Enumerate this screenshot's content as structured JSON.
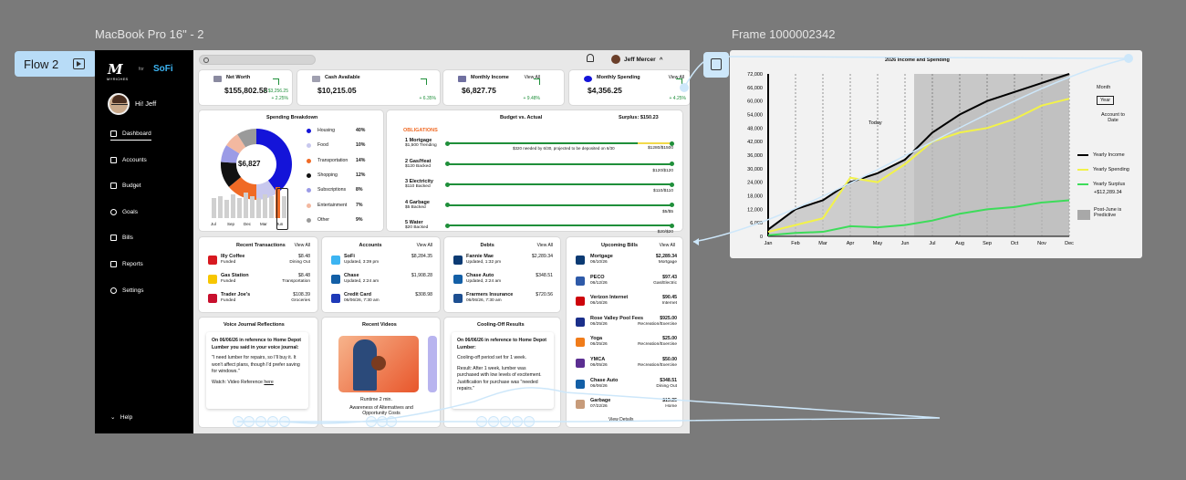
{
  "canvas": {
    "frame1_label": "MacBook Pro 16\" - 2",
    "frame2_label": "Frame 1000002342",
    "flow_label": "Flow 2"
  },
  "sidebar": {
    "logo_text": "M",
    "logo_sub": "MYRICHES",
    "logo_for": "for",
    "logo_partner": "SoFi",
    "greeting": "Hi! Jeff",
    "items": [
      {
        "label": "Dashboard",
        "icon": "home-icon",
        "active": true
      },
      {
        "label": "Accounts",
        "icon": "accounts-icon",
        "active": false
      },
      {
        "label": "Budget",
        "icon": "budget-icon",
        "active": false
      },
      {
        "label": "Goals",
        "icon": "goals-icon",
        "active": false
      },
      {
        "label": "Bills",
        "icon": "bills-icon",
        "active": false
      },
      {
        "label": "Reports",
        "icon": "reports-icon",
        "active": false
      },
      {
        "label": "Settings",
        "icon": "settings-icon",
        "active": false
      }
    ],
    "help": "Help"
  },
  "topbar": {
    "user_name": "Jeff Mercer"
  },
  "kpis": [
    {
      "title": "Net Worth",
      "value": "$155,802.58",
      "delta1": "+ $3,256.25",
      "delta2": "+ 2.25%",
      "view_all": ""
    },
    {
      "title": "Cash Available",
      "value": "$10,215.05",
      "delta1": "",
      "delta2": "+ 6.35%",
      "view_all": ""
    },
    {
      "title": "Monthly Income",
      "value": "$6,827.75",
      "delta1": "",
      "delta2": "+ 9.48%",
      "view_all": "View All"
    },
    {
      "title": "Monthly Spending",
      "value": "$4,356.25",
      "delta1": "",
      "delta2": "+ 4.25%",
      "view_all": "View All"
    }
  ],
  "spending": {
    "title": "Spending Breakdown",
    "total": "$6,827",
    "categories": [
      {
        "name": "Housing",
        "pct": "40%",
        "value": 40,
        "color": "#1414d9"
      },
      {
        "name": "Food",
        "pct": "10%",
        "value": 10,
        "color": "#c8c8ee"
      },
      {
        "name": "Transportation",
        "pct": "14%",
        "value": 14,
        "color": "#f06a25"
      },
      {
        "name": "Shopping",
        "pct": "12%",
        "value": 12,
        "color": "#111111"
      },
      {
        "name": "Subscriptions",
        "pct": "8%",
        "value": 8,
        "color": "#9b9be6"
      },
      {
        "name": "Entertainment",
        "pct": "7%",
        "value": 7,
        "color": "#f3b8a0"
      },
      {
        "name": "Other",
        "pct": "9%",
        "value": 9,
        "color": "#9a9a9a"
      }
    ],
    "bar_labels": [
      "Jul",
      "Sep",
      "Dec",
      "Mar",
      "Jun"
    ],
    "bar_values": [
      0.55,
      0.6,
      0.5,
      0.65,
      0.55,
      0.7,
      0.6,
      0.55,
      0.65,
      0.6,
      0.85,
      0.6
    ]
  },
  "budget": {
    "title": "Budget vs. Actual",
    "surplus": "Surplus: $150.23",
    "section": "OBLIGATIONS",
    "note": "$320 needed by 6/30, projected to be deposited on 6/30",
    "items": [
      {
        "name": "1 Mortgage",
        "sub": "$1,500 Trending",
        "amount": "$1280/$1500",
        "fill": 0.85,
        "partial": true
      },
      {
        "name": "2 Gas/Heat",
        "sub": "$120 Backed",
        "amount": "$120/$120",
        "fill": 1,
        "partial": false
      },
      {
        "name": "3 Electricity",
        "sub": "$110 Backed",
        "amount": "$110/$110",
        "fill": 1,
        "partial": false
      },
      {
        "name": "4 Garbage",
        "sub": "$5 Backed",
        "amount": "$5/$5",
        "fill": 1,
        "partial": false
      },
      {
        "name": "5 Water",
        "sub": "$20 Backed",
        "amount": "$20/$20",
        "fill": 1,
        "partial": false
      }
    ]
  },
  "transactions": {
    "title": "Recent Transactions",
    "view_all": "View All",
    "items": [
      {
        "name": "Illy Coffee",
        "status": "Funded",
        "amount": "$8.48",
        "category": "Dining Out",
        "icon": "illy-logo-icon",
        "color": "#d71920"
      },
      {
        "name": "Gas Station",
        "status": "Funded",
        "amount": "$8.48",
        "category": "Transportation",
        "icon": "shell-logo-icon",
        "color": "#f7c600"
      },
      {
        "name": "Trader Joe's",
        "status": "Funded",
        "amount": "$108.39",
        "category": "Groceries",
        "icon": "trader-joes-logo-icon",
        "color": "#c8102e"
      }
    ]
  },
  "accounts": {
    "title": "Accounts",
    "view_all": "View All",
    "items": [
      {
        "name": "SoFi",
        "updated": "Updated, 3:39 pm",
        "amount": "$8,284.35",
        "icon": "sofi-logo-icon",
        "color": "#3cb4f2"
      },
      {
        "name": "Chase",
        "updated": "Updated, 2:24 am",
        "amount": "$1,908.28",
        "icon": "chase-logo-icon",
        "color": "#135fa6"
      },
      {
        "name": "Credit Card",
        "updated": "06/06/26, 7:30 am",
        "amount": "$308.98",
        "icon": "card-logo-icon",
        "color": "#1e3ab8"
      }
    ]
  },
  "debts": {
    "title": "Debts",
    "view_all": "View All",
    "items": [
      {
        "name": "Fannie Mae",
        "updated": "Updated, 1:32 pm",
        "amount": "$2,289.34",
        "icon": "fannie-mae-logo-icon",
        "color": "#0b3a73"
      },
      {
        "name": "Chase Auto",
        "updated": "Updated, 2:24 am",
        "amount": "$348.51",
        "icon": "chase-logo-icon",
        "color": "#135fa6"
      },
      {
        "name": "Frarmers Insurance",
        "updated": "06/06/26, 7:30 am",
        "amount": "$720.56",
        "icon": "farmers-logo-icon",
        "color": "#1d4f91"
      }
    ]
  },
  "bills": {
    "title": "Upcoming Bills",
    "view_all": "View All",
    "view_details": "View Details",
    "items": [
      {
        "name": "Mortgage",
        "date": "06/10/26",
        "amount": "$2,289.34",
        "category": "Mortgage",
        "icon": "fannie-mae-logo-icon",
        "color": "#0b3a73"
      },
      {
        "name": "PECO",
        "date": "06/12/26",
        "amount": "$97.43",
        "category": "Gas/Electric",
        "icon": "peco-logo-icon",
        "color": "#2e5aa8"
      },
      {
        "name": "Verizon Internet",
        "date": "06/16/26",
        "amount": "$90.45",
        "category": "Internet",
        "icon": "verizon-logo-icon",
        "color": "#cd040b"
      },
      {
        "name": "Rose Valley Pool Fees",
        "date": "06/25/26",
        "amount": "$925.00",
        "category": "Recreation/Exercise",
        "icon": "pool-logo-icon",
        "color": "#1a2f8a"
      },
      {
        "name": "Yoga",
        "date": "06/25/26",
        "amount": "$25.00",
        "category": "Recreation/Exercise",
        "icon": "yoga-logo-icon",
        "color": "#f07c1a"
      },
      {
        "name": "YMCA",
        "date": "06/05/26",
        "amount": "$50.00",
        "category": "Recreation/Exercise",
        "icon": "ymca-logo-icon",
        "color": "#5b2e91"
      },
      {
        "name": "Chase Auto",
        "date": "06/06/26",
        "amount": "$348.51",
        "category": "Dining Out",
        "icon": "chase-logo-icon",
        "color": "#135fa6"
      },
      {
        "name": "Garbage",
        "date": "07/22/26",
        "amount": "$15.25",
        "category": "Home",
        "icon": "garbage-logo-icon",
        "color": "#c79b7a"
      }
    ]
  },
  "journal": {
    "title": "Voice Journal Reflections",
    "heading": "On 06/06/26 in reference to Home Depot Lumber you said in your voice journal:",
    "quote": "\"I need lumber for repairs, so I'll buy it. It won't affect plans, though I'd prefer saving for windows.\"",
    "watch": "Watch: Video Reference",
    "here": "here"
  },
  "videos": {
    "title": "Recent Videos",
    "runtime": "Runtime 2 min.",
    "caption": "Awareness of Alternatives and Opportunity Costs"
  },
  "cooling": {
    "title": "Cooling-Off Results",
    "heading": "On 06/06/26 in reference to Home Depot Lumber:",
    "period": "Cooling-off period set for 1 week.",
    "result": "Result: After 1 week, lumber was purchased with low levels of excitement. Justification for purchase was \"needed repairs.\""
  },
  "chart_data": {
    "type": "line",
    "title": "2026 Income and Spending",
    "x": [
      "Jan",
      "Feb",
      "Mar",
      "Apr",
      "May",
      "Jun",
      "Jul",
      "Aug",
      "Sep",
      "Oct",
      "Nov",
      "Dec"
    ],
    "y_ticks": [
      "72,000",
      "66,000",
      "60,000",
      "54,000",
      "48,000",
      "42,000",
      "36,000",
      "30,000",
      "24,000",
      "18,000",
      "12,000",
      "6,000",
      "0"
    ],
    "ylim": [
      0,
      72000
    ],
    "annotation": "Today",
    "series": [
      {
        "name": "Yearly Income",
        "color": "#000000",
        "values": [
          3000,
          12000,
          16000,
          24000,
          28000,
          34000,
          46000,
          54000,
          60000,
          64000,
          68000,
          72000
        ]
      },
      {
        "name": "Yearly Spending",
        "color": "#f2f24a",
        "values": [
          2000,
          5000,
          8000,
          26000,
          24000,
          32000,
          42000,
          46000,
          48000,
          52000,
          58000,
          61000
        ]
      },
      {
        "name": "Yearly Surplus",
        "color": "#3ddc5a",
        "values": [
          500,
          1500,
          2000,
          4500,
          4000,
          5000,
          7000,
          10000,
          12000,
          13000,
          15000,
          16000
        ]
      }
    ],
    "surplus_total": "+$12,289.34",
    "legend": {
      "month_label": "Month",
      "year_label": "Year",
      "account_label": "Account to Date",
      "predictive": "Post-June is Predictive"
    },
    "predictive_from": "Jun",
    "grid": true
  }
}
